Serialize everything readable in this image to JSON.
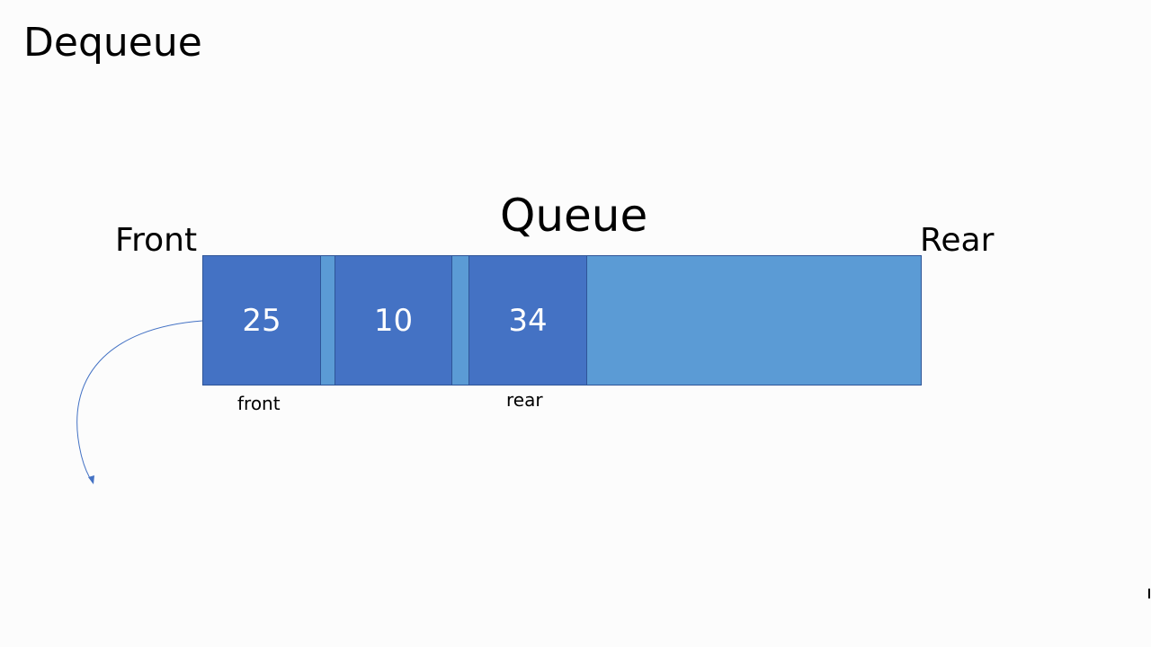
{
  "slide": {
    "title": "Dequeue"
  },
  "diagram": {
    "queue_title": "Queue",
    "front_end_label": "Front",
    "rear_end_label": "Rear",
    "cells": [
      "25",
      "10",
      "34"
    ],
    "front_pointer_label": "front",
    "rear_pointer_label": "rear"
  },
  "colors": {
    "background": "#fcfcfc",
    "queue_bar": "#5b9bd5",
    "cell": "#4472c4",
    "cell_border": "#2f5597",
    "arrow": "#4472c4"
  }
}
